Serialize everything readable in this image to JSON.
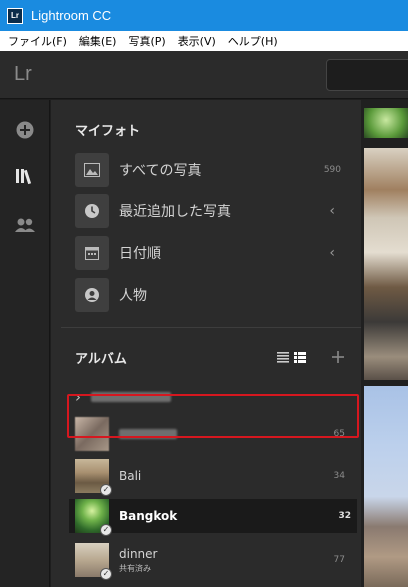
{
  "window": {
    "app_icon_text": "Lr",
    "title": "Lightroom CC"
  },
  "menu": [
    "ファイル(F)",
    "編集(E)",
    "写真(P)",
    "表示(V)",
    "ヘルプ(H)"
  ],
  "appbar": {
    "logo": "Lr"
  },
  "left_rail": {
    "icons": [
      "add-icon",
      "library-icon",
      "people-icon"
    ]
  },
  "my_photos": {
    "title": "マイフォト",
    "items": [
      {
        "label": "すべての写真",
        "count": "590",
        "icon": "image-icon"
      },
      {
        "label": "最近追加した写真",
        "count": "",
        "icon": "clock-icon",
        "chevron": "‹"
      },
      {
        "label": "日付順",
        "count": "",
        "icon": "calendar-icon",
        "chevron": "‹"
      },
      {
        "label": "人物",
        "count": "",
        "icon": "person-icon"
      }
    ]
  },
  "albums": {
    "title": "アルバム",
    "tools": {
      "list_icon": "list-view-icon",
      "grid_icon": "grid-view-icon",
      "add_icon": "add-album-icon"
    },
    "folder_chevron": "›",
    "rows": [
      {
        "name": "",
        "count": "",
        "blurred": true,
        "folder": true
      },
      {
        "name": "",
        "count": "65",
        "blurred": true
      },
      {
        "name": "Bali",
        "count": "34"
      },
      {
        "name": "Bangkok",
        "count": "32",
        "selected": true
      },
      {
        "name": "dinner",
        "count": "77",
        "shared_label": "共有済み"
      }
    ]
  },
  "colors": {
    "titlebar": "#1a8be0",
    "highlight": "#d6171f",
    "panel": "#2b2b2b"
  }
}
